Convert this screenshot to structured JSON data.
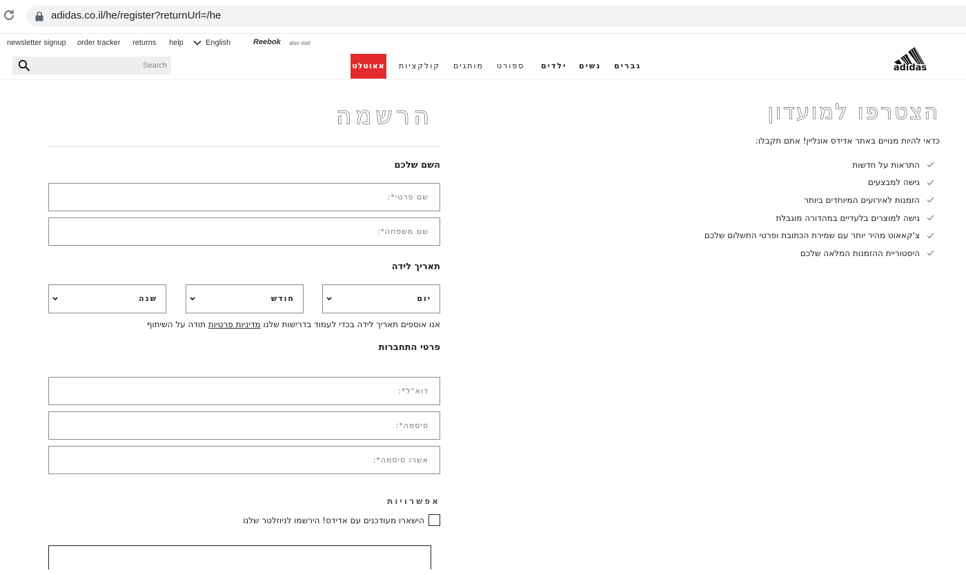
{
  "browser": {
    "url": "adidas.co.il/he/register?returnUrl=/he"
  },
  "utility": {
    "links": [
      "newsletter signup",
      "order tracker",
      "returns",
      "help"
    ],
    "language": "English",
    "reebok": "Reebok",
    "also_visit": "also visit"
  },
  "nav": {
    "search_placeholder": "Search",
    "items": [
      "גברים",
      "נשים",
      "ילדים",
      "ספורט",
      "מותגים",
      "קולקציות"
    ],
    "outlet": "אאוטלט",
    "accent_color": "#e32b2b"
  },
  "join": {
    "title": "הצטרפו למועדון",
    "subtitle": "כדאי להיות מנויים באתר אדידס אונליין! אתם תקבלו:",
    "benefits": [
      "התראות על חדשות",
      "גישה למבצעים",
      "הזמנות לאירועים המיוחדים ביותר",
      "גישה למוצרים בלעדיים במהדורה מוגבלת",
      "צ'קאאוט מהיר יותר עם שמירת הכתובת ופרטי התשלום שלכם",
      "היסטוריית ההזמנות המלאה שלכם"
    ]
  },
  "form": {
    "title": "הרשמה",
    "name_section": "השם שלכם",
    "first_name_placeholder": "שם פרטי*:",
    "last_name_placeholder": "שם משפחה*:",
    "dob_section": "תאריך לידה",
    "day": "יום",
    "month": "חודש",
    "year": "שנה",
    "privacy_before": "אנו אוספים תאריך לידה בכדי לעמוד בדרישות שלנו ",
    "privacy_link": "מדיניות פרטיות",
    "privacy_after": " תודה על השיתוף",
    "login_section": "פרטי התחברות",
    "email_placeholder": "דוא\"ל*:",
    "password_placeholder": "סיסמה*:",
    "confirm_password_placeholder": "אשרו סיסמה*:",
    "options_section": "אפשרויות",
    "newsletter_label": "הישארו מעודכנים עם אדידס! הירשמו לניוזלטר שלנו"
  }
}
